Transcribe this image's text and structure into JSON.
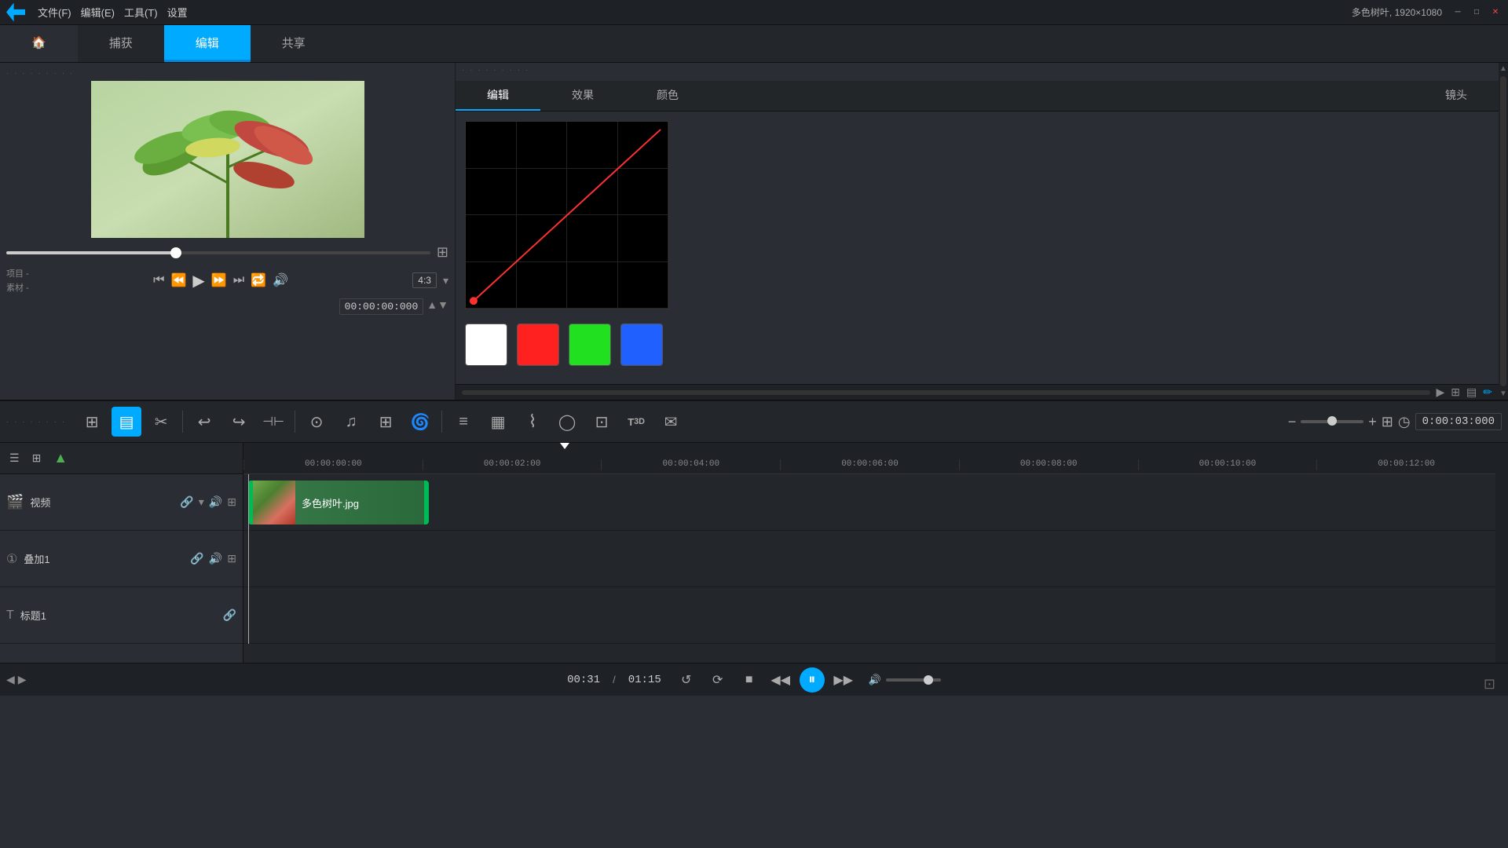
{
  "titleBar": {
    "appLogo": "▶",
    "menus": [
      "文件(F)",
      "编辑(E)",
      "工具(T)",
      "设置"
    ],
    "titleInfo": "多色树叶, 1920×1080",
    "windowControls": {
      "minimize": "─",
      "maximize": "□",
      "close": "✕"
    }
  },
  "navTabs": [
    {
      "label": "🏠",
      "id": "home",
      "active": false
    },
    {
      "label": "捕获",
      "id": "capture",
      "active": false
    },
    {
      "label": "编辑",
      "id": "edit",
      "active": true
    },
    {
      "label": "共享",
      "id": "share",
      "active": false
    }
  ],
  "preview": {
    "projectLabel": "项目 -",
    "sourceLabel": "素材 -",
    "timecode": "00:00:00:000",
    "aspectRatio": "4:3",
    "screenIcon": "⊞"
  },
  "effectPanel": {
    "tabs": [
      "编辑",
      "效果",
      "颜色",
      "镜头"
    ],
    "activeTab": "编辑",
    "curve": {
      "colors": [
        "#ffffff",
        "#ff2020",
        "#20e020",
        "#2060ff"
      ]
    }
  },
  "toolbar": {
    "buttons": [
      {
        "icon": "⊞",
        "label": "video-mode",
        "active": false
      },
      {
        "icon": "▤",
        "label": "storyboard",
        "active": true
      },
      {
        "icon": "✂",
        "label": "split",
        "active": false
      },
      {
        "icon": "↩",
        "label": "undo",
        "active": false
      },
      {
        "icon": "↪",
        "label": "redo",
        "active": false
      },
      {
        "icon": "⊣⊢",
        "label": "trim",
        "active": false
      },
      {
        "icon": "⊙",
        "label": "effects",
        "active": false
      },
      {
        "icon": "♫",
        "label": "audio",
        "active": false
      },
      {
        "icon": "⊞",
        "label": "mosaic",
        "active": false
      },
      {
        "icon": "🌀",
        "label": "transition",
        "active": false
      },
      {
        "icon": "≡",
        "label": "text",
        "active": false
      },
      {
        "icon": "▦",
        "label": "table",
        "active": false
      },
      {
        "icon": "~",
        "label": "motion",
        "active": false
      },
      {
        "icon": "◯",
        "label": "mask",
        "active": false
      },
      {
        "icon": "⊡",
        "label": "stabilize",
        "active": false
      },
      {
        "icon": "T3D",
        "label": "3dtext",
        "active": false
      },
      {
        "icon": "✉",
        "label": "share",
        "active": false
      }
    ],
    "zoomOut": "−",
    "zoomIn": "+",
    "fitBtn": "⊞",
    "clockIcon": "◷",
    "timeDisplay": "0:00:03:000"
  },
  "timeline": {
    "rulerMarks": [
      "00:00:00:00",
      "00:00:02:00",
      "00:00:04:00",
      "00:00:06:00",
      "00:00:08:00",
      "00:00:10:00",
      "00:00:12:00"
    ],
    "tracks": [
      {
        "name": "视频",
        "icon": "🎬",
        "clips": [
          {
            "label": "多色树叶.jpg",
            "color": "#2a6a3a"
          }
        ]
      },
      {
        "name": "叠加1",
        "icon": "①",
        "clips": []
      },
      {
        "name": "标题1",
        "icon": "",
        "clips": []
      }
    ]
  },
  "statusBar": {
    "currentTime": "00:31",
    "totalTime": "01:15",
    "loopBtn": "↺",
    "returnBtn": "⟳",
    "stopBtn": "■",
    "rewindBtn": "◀◀",
    "playPauseBtn": "⏸",
    "ffwdBtn": "▶▶",
    "volumeIcon": "🔊"
  }
}
